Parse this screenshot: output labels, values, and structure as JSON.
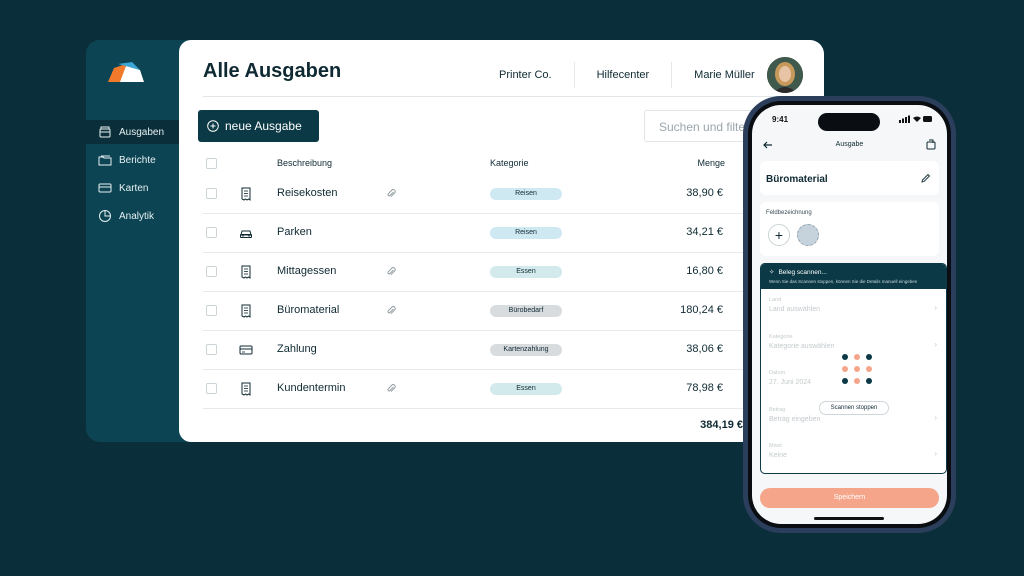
{
  "app": {
    "title": "Alle Ausgaben",
    "topnav": {
      "company": "Printer Co.",
      "help": "Hilfecenter",
      "user": "Marie Müller"
    },
    "sidebar": {
      "items": [
        {
          "label": "Ausgaben",
          "icon": "wallet-icon",
          "active": true
        },
        {
          "label": "Berichte",
          "icon": "folder-icon",
          "active": false
        },
        {
          "label": "Karten",
          "icon": "card-icon",
          "active": false
        },
        {
          "label": "Analytik",
          "icon": "pie-chart-icon",
          "active": false
        }
      ]
    },
    "add_button": "neue Ausgabe",
    "search_placeholder": "Suchen und filtern",
    "table": {
      "headers": {
        "description": "Beschreibung",
        "category": "Kategorie",
        "amount": "Menge"
      },
      "rows": [
        {
          "description": "Reisekosten",
          "category": "Reisen",
          "amount": "38,90 €",
          "icon": "receipt-icon",
          "attachment": true
        },
        {
          "description": "Parken",
          "category": "Reisen",
          "amount": "34,21 €",
          "icon": "car-icon",
          "attachment": false
        },
        {
          "description": "Mittagessen",
          "category": "Essen",
          "amount": "16,80 €",
          "icon": "receipt-icon",
          "attachment": true
        },
        {
          "description": "Büromaterial",
          "category": "Bürobedarf",
          "amount": "180,24 €",
          "icon": "receipt-icon",
          "attachment": true
        },
        {
          "description": "Zahlung",
          "category": "Kartenzahlung",
          "amount": "38,06 €",
          "icon": "card-icon",
          "attachment": false
        },
        {
          "description": "Kundentermin",
          "category": "Essen",
          "amount": "78,98 €",
          "icon": "receipt-icon",
          "attachment": true
        }
      ],
      "total": "384,19 €"
    },
    "colors": {
      "sidebar": "#0d4453",
      "primary": "#0b3945",
      "accent": "#f5a58a"
    }
  },
  "phone": {
    "time": "9:41",
    "title": "Ausgabe",
    "expense_name": "Büromaterial",
    "field_label": "Feldbezeichnung",
    "scan": {
      "title": "Beleg scannen...",
      "subtitle": "Wenn Sie das Scannen stoppen, können Sie die Details manuell eingeben",
      "stop_button": "Scannen stoppen",
      "fields": [
        {
          "label": "Land",
          "value": "Land auswählen"
        },
        {
          "label": "Kategorie",
          "value": "Kategorie auswählen"
        },
        {
          "label": "Datum",
          "value": "27. Juni 2024"
        },
        {
          "label": "Betrag",
          "value": "Betrag eingeben"
        },
        {
          "label": "Mwst",
          "value": "Keine"
        }
      ]
    },
    "save_button": "Speichern"
  }
}
